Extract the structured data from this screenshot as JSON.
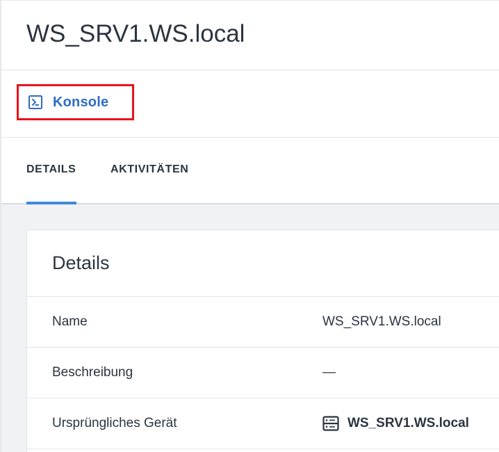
{
  "header": {
    "title": "WS_SRV1.WS.local"
  },
  "actions": {
    "console_label": "Konsole",
    "console_icon": "terminal-icon",
    "highlight_color": "#e8131b"
  },
  "tabs": [
    {
      "label": "DETAILS",
      "active": true
    },
    {
      "label": "AKTIVITÄTEN",
      "active": false
    }
  ],
  "details_card": {
    "title": "Details",
    "rows": [
      {
        "label": "Name",
        "value": "WS_SRV1.WS.local"
      },
      {
        "label": "Beschreibung",
        "value": "—"
      },
      {
        "label": "Ursprüngliches Gerät",
        "value": "WS_SRV1.WS.local",
        "icon": "server-icon"
      }
    ]
  },
  "colors": {
    "accent": "#2e6cc3",
    "tab_indicator": "#3f8ad8",
    "text": "#2b3440",
    "content_background": "#f1f2f3"
  }
}
